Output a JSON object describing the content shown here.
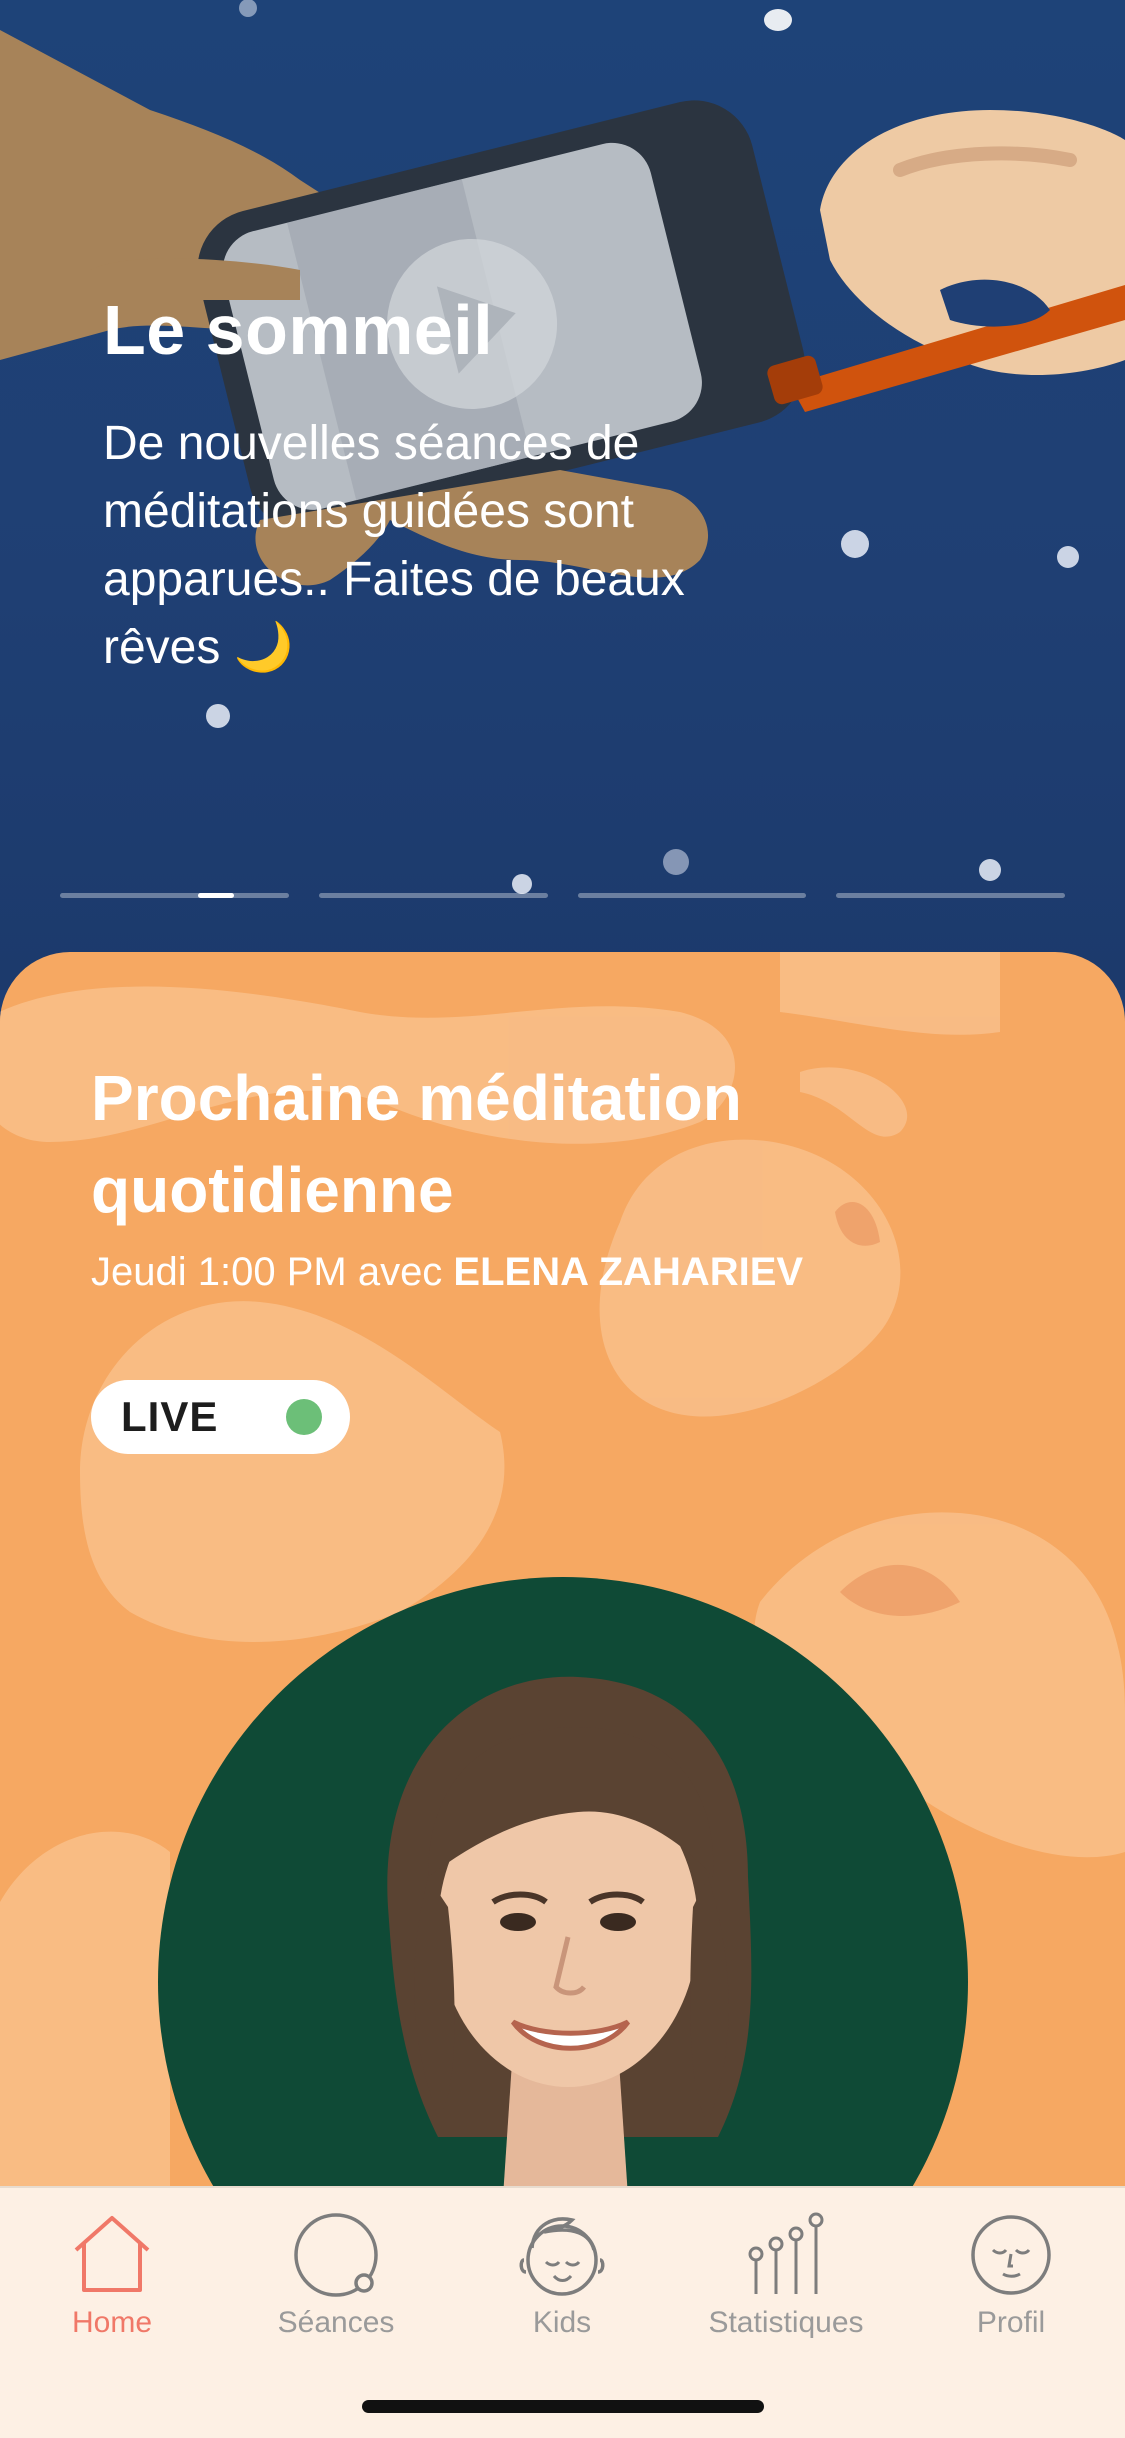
{
  "hero": {
    "title": "Le sommeil",
    "text": "De nouvelles séances de méditations guidées sont apparues.. Faites de beaux rêves 🌙",
    "pager": {
      "count": 4,
      "active_index": 0
    }
  },
  "next_meditation": {
    "title": "Prochaine méditation quotidienne",
    "schedule": "Jeudi 1:00 PM avec ",
    "teacher": "ELENA ZAHARIEV",
    "live_label": "LIVE",
    "live_status_color": "#6cbf78"
  },
  "tabbar": {
    "items": [
      {
        "label": "Home",
        "icon": "home-icon",
        "active": true
      },
      {
        "label": "Séances",
        "icon": "sessions-circle-icon",
        "active": false
      },
      {
        "label": "Kids",
        "icon": "kids-face-icon",
        "active": false
      },
      {
        "label": "Statistiques",
        "icon": "stats-icon",
        "active": false
      },
      {
        "label": "Profil",
        "icon": "profile-face-icon",
        "active": false
      }
    ]
  },
  "colors": {
    "hero_bg": "#1f3f74",
    "card_bg": "#f6a862",
    "tabbar_bg": "#fdf0e4",
    "accent": "#f07868"
  }
}
